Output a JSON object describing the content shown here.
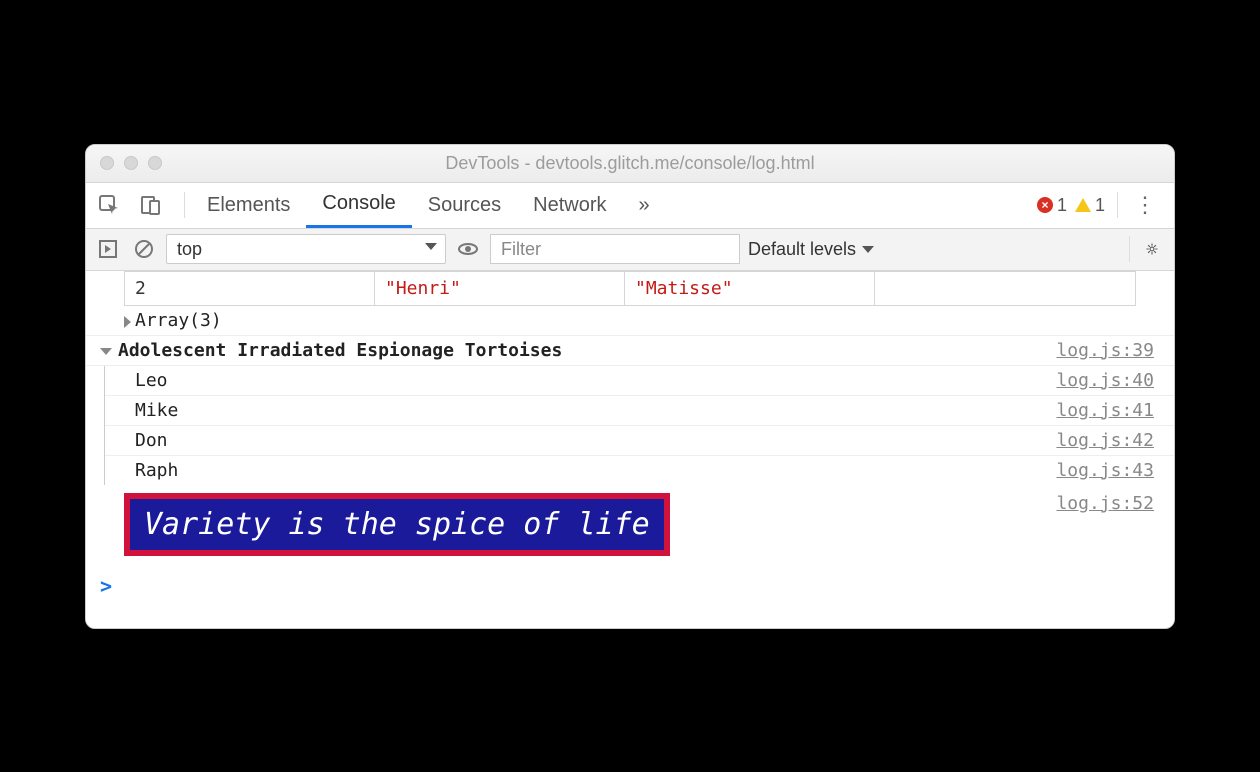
{
  "window": {
    "title": "DevTools - devtools.glitch.me/console/log.html"
  },
  "tabs": {
    "elements": "Elements",
    "console": "Console",
    "sources": "Sources",
    "network": "Network",
    "more": "»"
  },
  "status": {
    "errors": "1",
    "warnings": "1"
  },
  "toolbar": {
    "context": "top",
    "filter_placeholder": "Filter",
    "levels": "Default levels"
  },
  "console": {
    "table": {
      "index": "2",
      "first": "\"Henri\"",
      "last": "\"Matisse\""
    },
    "array_summary": "Array(3)",
    "group": {
      "title": "Adolescent Irradiated Espionage Tortoises",
      "src": "log.js:39",
      "items": [
        {
          "text": "Leo",
          "src": "log.js:40"
        },
        {
          "text": "Mike",
          "src": "log.js:41"
        },
        {
          "text": "Don",
          "src": "log.js:42"
        },
        {
          "text": "Raph",
          "src": "log.js:43"
        }
      ]
    },
    "styled": {
      "text": "Variety is the spice of life",
      "src": "log.js:52"
    },
    "prompt": ">"
  }
}
